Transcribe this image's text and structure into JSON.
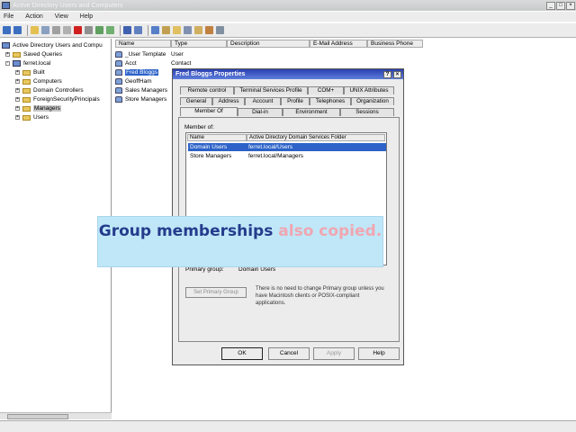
{
  "window": {
    "title": "Active Directory Users and Computers"
  },
  "menu": [
    "File",
    "Action",
    "View",
    "Help"
  ],
  "tree": [
    {
      "label": "Active Directory Users and Compu",
      "indent": 0,
      "icon": "domain"
    },
    {
      "label": "Saved Queries",
      "indent": 1,
      "icon": "folder"
    },
    {
      "label": "ferret.local",
      "indent": 1,
      "icon": "domain"
    },
    {
      "label": "Built",
      "indent": 2,
      "icon": "folder"
    },
    {
      "label": "Computers",
      "indent": 2,
      "icon": "folder"
    },
    {
      "label": "Domain Controllers",
      "indent": 2,
      "icon": "folder"
    },
    {
      "label": "ForeignSecurityPrincipals",
      "indent": 2,
      "icon": "folder"
    },
    {
      "label": "Managers",
      "indent": 2,
      "icon": "folder",
      "selected": true
    },
    {
      "label": "Users",
      "indent": 2,
      "icon": "folder"
    }
  ],
  "list": {
    "columns": [
      "Name",
      "Type",
      "Description",
      "E-Mail Address",
      "Business Phone"
    ],
    "rows": [
      {
        "name": "_User Template",
        "type": "User"
      },
      {
        "name": "Acct",
        "type": "Contact"
      },
      {
        "name": "Fred Bloggs",
        "type": "",
        "selected": true
      },
      {
        "name": "GeoffHam",
        "type": ""
      },
      {
        "name": "Sales Managers",
        "type": ""
      },
      {
        "name": "Store Managers",
        "type": ""
      }
    ]
  },
  "dialog": {
    "title": "Fred Bloggs Properties",
    "tabs_row1": [
      "Remote control",
      "Terminal Services Profile",
      "COM+",
      "UNIX Attributes"
    ],
    "tabs_row2": [
      "General",
      "Address",
      "Account",
      "Profile",
      "Telephones",
      "Organization"
    ],
    "tabs_row3": [
      "Member Of",
      "Dial-in",
      "Environment",
      "Sessions"
    ],
    "member_of_label": "Member of:",
    "member_columns": [
      "Name",
      "Active Directory Domain Services Folder"
    ],
    "members": [
      {
        "name": "Domain Users",
        "folder": "ferret.local/Users",
        "selected": true
      },
      {
        "name": "Store Managers",
        "folder": "ferret.local/Managers"
      }
    ],
    "primary_group_label": "Primary group:",
    "primary_group_value": "Domain Users",
    "set_primary_label": "Set Primary Group",
    "note": "There is no need to change Primary group unless you have Macintosh clients or POSIX-compliant applications.",
    "buttons": {
      "ok": "OK",
      "cancel": "Cancel",
      "apply": "Apply",
      "help": "Help"
    }
  },
  "callout": {
    "part1": "Group memberships ",
    "part2": "also copied."
  }
}
